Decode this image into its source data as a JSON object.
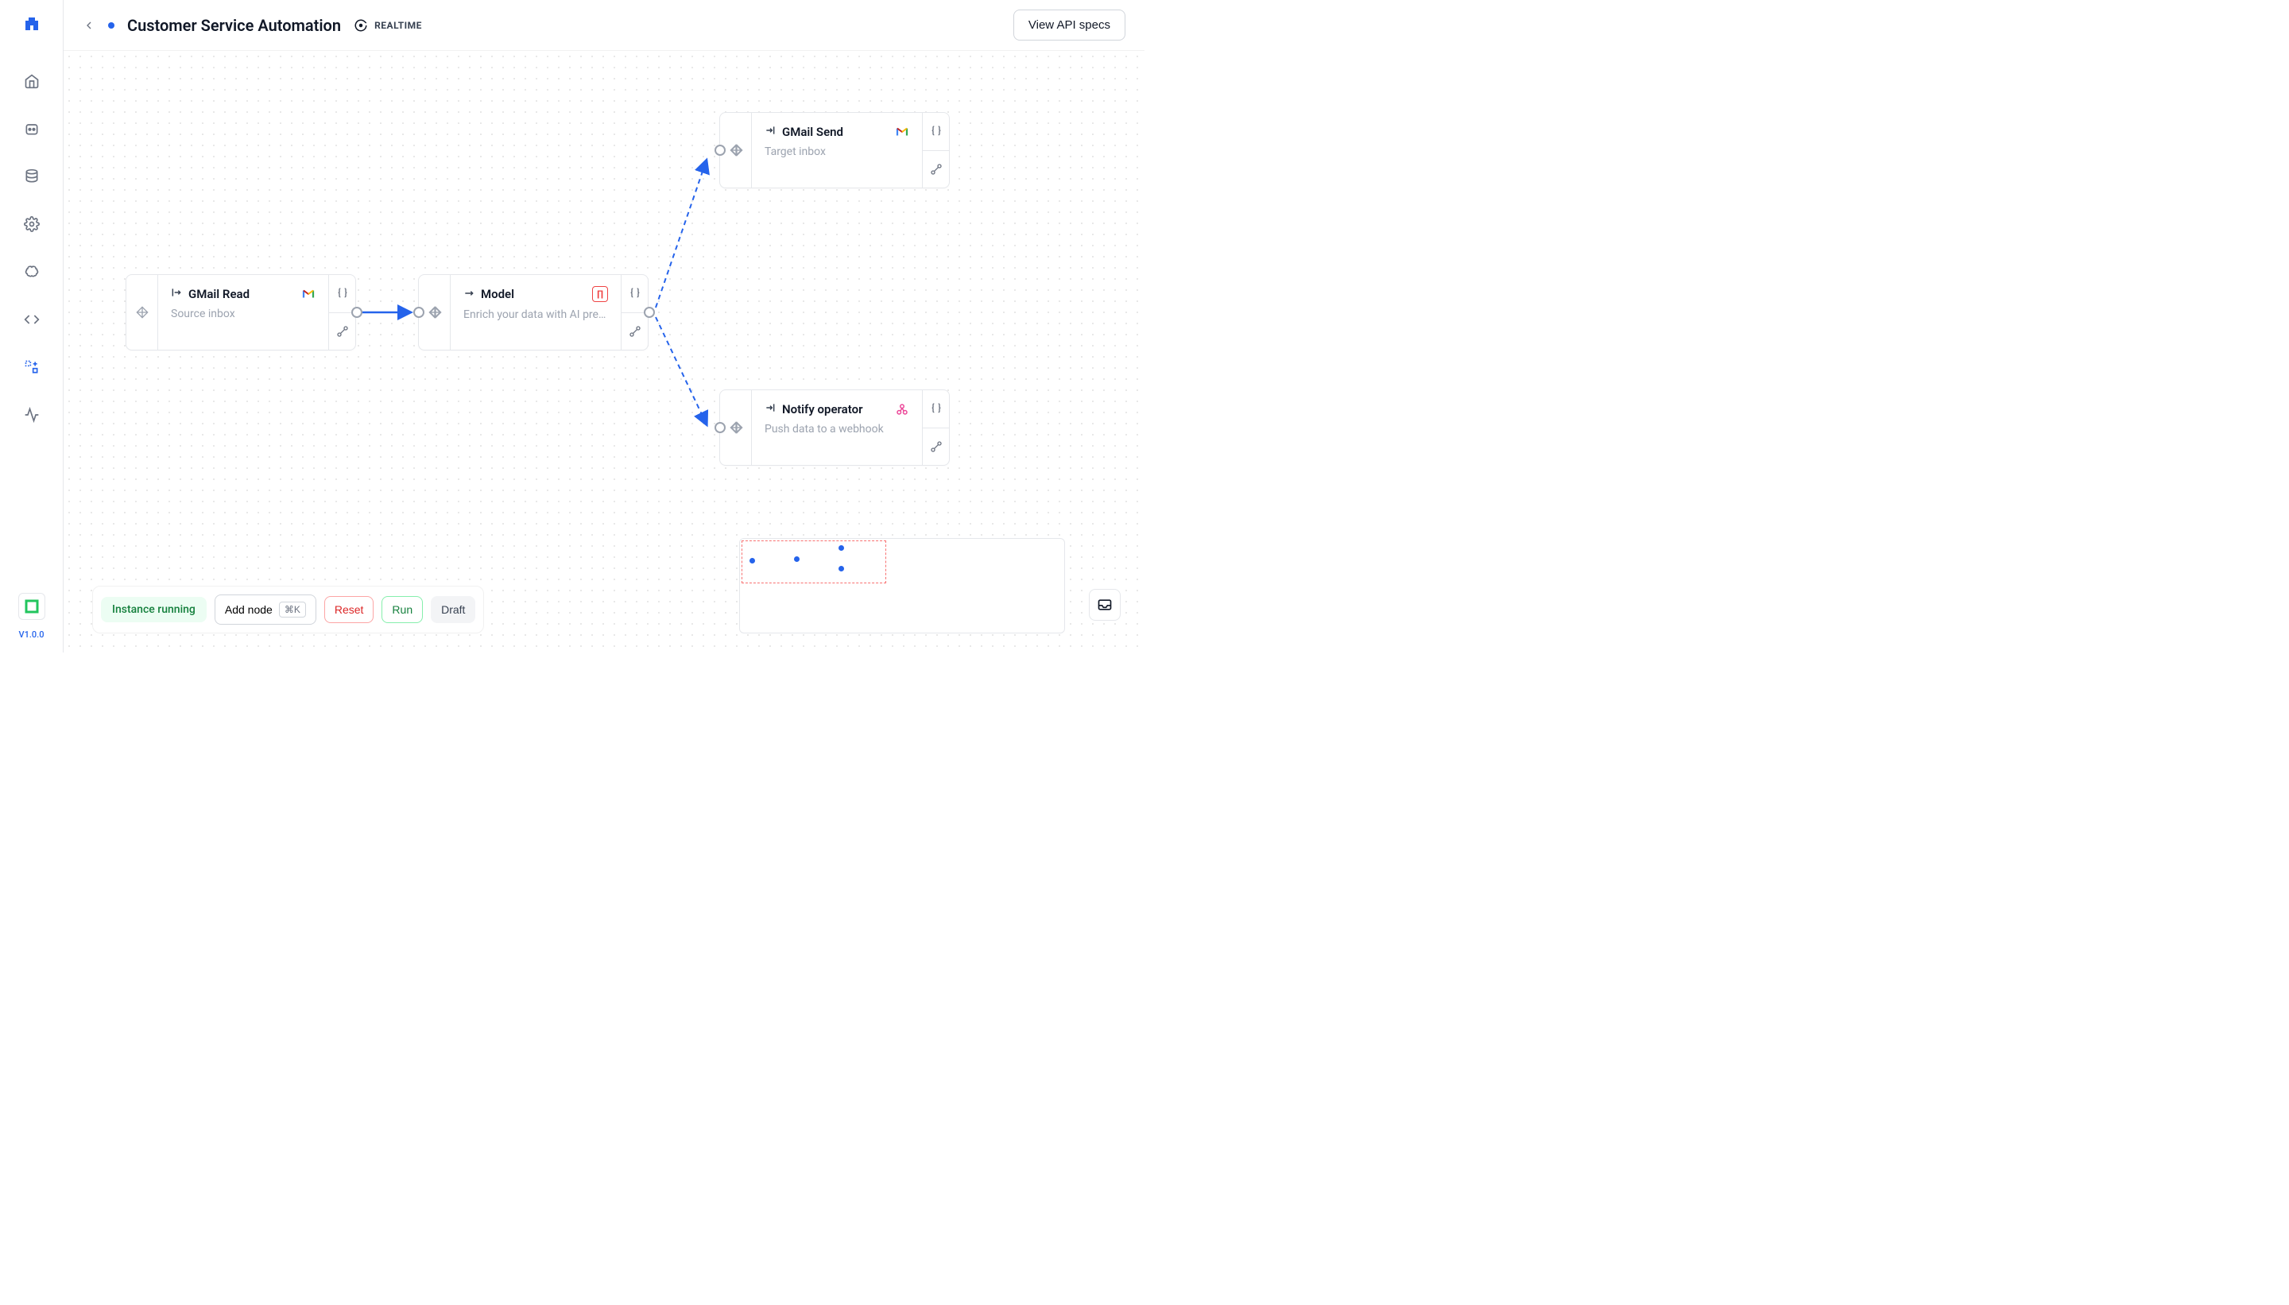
{
  "header": {
    "title": "Customer Service Automation",
    "mode": "REALTIME",
    "api_button": "View API specs"
  },
  "sidebar": {
    "version": "V1.0.0"
  },
  "nodes": {
    "gmail_read": {
      "title": "GMail Read",
      "desc": "Source inbox",
      "direction": "output"
    },
    "model": {
      "title": "Model",
      "desc": "Enrich your data with AI pre…",
      "direction": "transform"
    },
    "gmail_send": {
      "title": "GMail Send",
      "desc": "Target inbox",
      "direction": "input"
    },
    "notify": {
      "title": "Notify operator",
      "desc": "Push data to a webhook",
      "direction": "input"
    }
  },
  "toolbar": {
    "instance_status": "Instance running",
    "add_node": "Add node",
    "shortcut": "⌘K",
    "reset": "Reset",
    "run": "Run",
    "draft": "Draft"
  },
  "colors": {
    "primary": "#2563eb",
    "danger": "#dc2626",
    "success": "#15803d"
  }
}
